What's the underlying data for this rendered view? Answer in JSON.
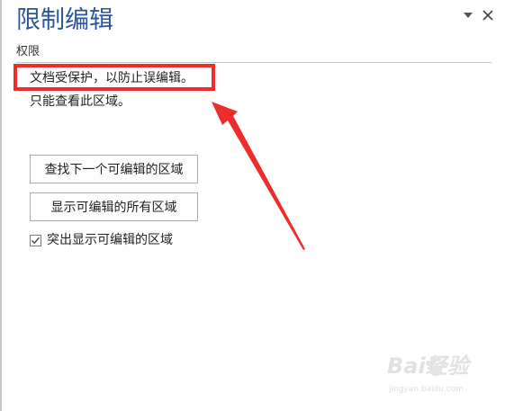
{
  "pane": {
    "title": "限制编辑",
    "options_icon": "chevron-down-icon",
    "close_icon": "close-icon"
  },
  "permissions": {
    "section_label": "权限",
    "status_line1": "文档受保护，以防止误编辑。",
    "status_line2": "只能查看此区域。",
    "find_next_button": "查找下一个可编辑的区域",
    "show_all_button": "显示可编辑的所有区域",
    "highlight_checkbox": {
      "label": "突出显示可编辑的区域",
      "checked": true
    }
  },
  "annotation": {
    "highlight_color": "#ee2c2c",
    "arrow_color": "#ee2c2c"
  },
  "watermark": {
    "brand": "Bai经验",
    "url": "jingyan.baidu.com"
  },
  "colors": {
    "title": "#2b579a",
    "divider": "#c6c6c6",
    "button_border": "#ababab"
  }
}
